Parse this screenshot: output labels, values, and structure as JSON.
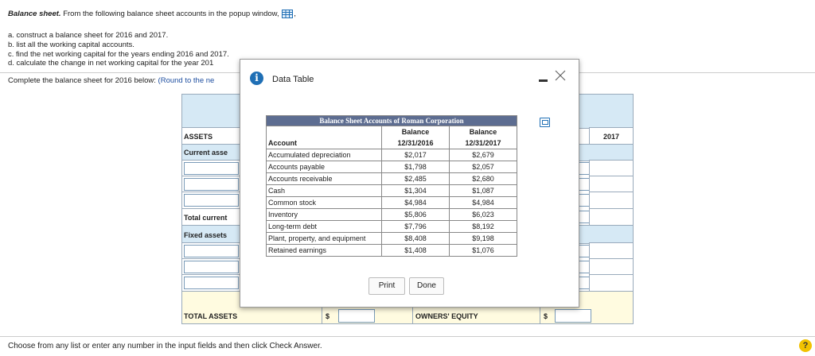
{
  "question": {
    "title_bold": "Balance sheet.",
    "title_rest": "From the following balance sheet accounts in the popup window,",
    "title_end": ",",
    "items": [
      "a. construct a balance sheet for 2016 and 2017.",
      "b. list all the working capital accounts.",
      "c. find the net working capital for the years ending 2016 and 2017.",
      "d. calculate the change in net working capital for the year 201"
    ],
    "instruction": "Complete the balance sheet for 2016 below:",
    "instruction_note": "(Round to the ne"
  },
  "worksheet": {
    "assets_label": "ASSETS",
    "current_assets_label": "Current asse",
    "total_current_label": "Total current",
    "fixed_assets_label": "Fixed assets",
    "year_2017": "2017",
    "total_assets_label": "TOTAL ASSETS",
    "dollar": "$",
    "owners_equity_label": "OWNERS' EQUITY",
    "dollar2": "$"
  },
  "popup": {
    "title": "Data Table",
    "table_caption": "Balance Sheet Accounts of Roman Corporation",
    "headers": {
      "account": "Account",
      "col1_top": "Balance",
      "col1_bottom": "12/31/2016",
      "col2_top": "Balance",
      "col2_bottom": "12/31/2017"
    },
    "rows": [
      {
        "account": "Accumulated depreciation",
        "y2016": "$2,017",
        "y2017": "$2,679"
      },
      {
        "account": "Accounts payable",
        "y2016": "$1,798",
        "y2017": "$2,057"
      },
      {
        "account": "Accounts receivable",
        "y2016": "$2,485",
        "y2017": "$2,680"
      },
      {
        "account": "Cash",
        "y2016": "$1,304",
        "y2017": "$1,087"
      },
      {
        "account": "Common stock",
        "y2016": "$4,984",
        "y2017": "$4,984"
      },
      {
        "account": "Inventory",
        "y2016": "$5,806",
        "y2017": "$6,023"
      },
      {
        "account": "Long-term debt",
        "y2016": "$7,796",
        "y2017": "$8,192"
      },
      {
        "account": "Plant, property, and equipment",
        "y2016": "$8,408",
        "y2017": "$9,198"
      },
      {
        "account": "Retained earnings",
        "y2016": "$1,408",
        "y2017": "$1,076"
      }
    ],
    "print_label": "Print",
    "done_label": "Done"
  },
  "footer": {
    "text": "Choose from any list or enter any number in the input fields and then click Check Answer.",
    "help": "?"
  },
  "colors": {
    "accent": "#1f6fb5",
    "table_caption_bg": "#5d6d91",
    "worksheet_blue": "#d6e9f5",
    "worksheet_yellow": "#fffbe0",
    "help_yellow": "#f2c200"
  }
}
